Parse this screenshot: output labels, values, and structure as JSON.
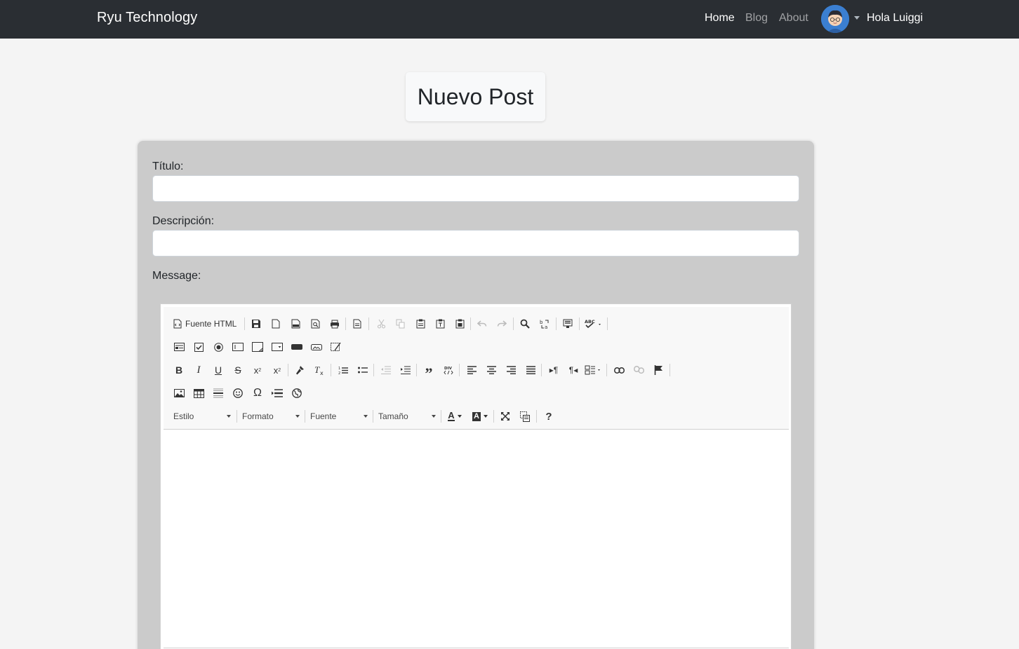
{
  "nav": {
    "brand": "Ryu Technology",
    "links": [
      {
        "label": "Home"
      },
      {
        "label": "Blog"
      },
      {
        "label": "About"
      }
    ],
    "user_greeting": "Hola Luiggi"
  },
  "page_title": "Nuevo Post",
  "form": {
    "title_label": "Título:",
    "title_value": "",
    "description_label": "Descripción:",
    "description_value": "",
    "message_label": "Message:"
  },
  "editor": {
    "source_label": "Fuente HTML",
    "combos": {
      "style": "Estilo",
      "format": "Formato",
      "font": "Fuente",
      "size": "Tamaño"
    },
    "help_glyph": "?",
    "text_color_glyph": "A",
    "bg_color_glyph": "A"
  },
  "colors": {
    "navbar": "#2a2e33",
    "card": "#cbcbcb",
    "page_bg": "#f4f4f4"
  }
}
